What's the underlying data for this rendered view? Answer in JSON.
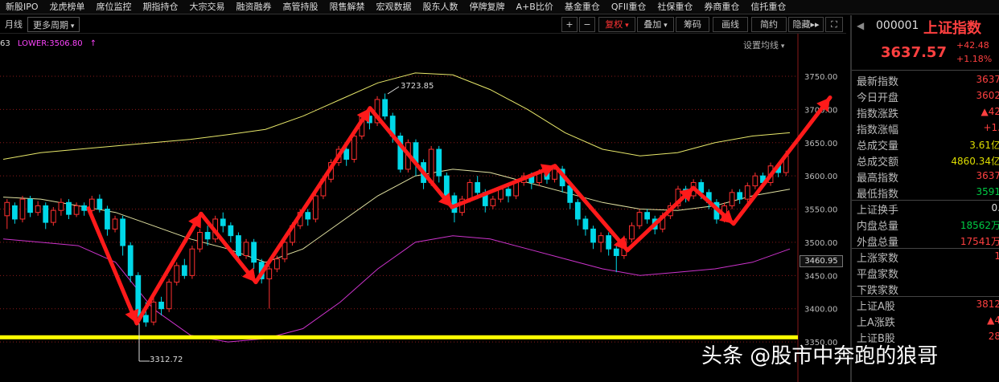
{
  "top_menu": [
    "新股IPO",
    "龙虎榜单",
    "席位监控",
    "期指持仓",
    "大宗交易",
    "融资融券",
    "高管持股",
    "限售解禁",
    "宏观数据",
    "股东人数",
    "停牌复牌",
    "A+B比价",
    "基金重仓",
    "QFII重仓",
    "社保重仓",
    "券商重仓",
    "信托重仓"
  ],
  "toolbar": {
    "month_label": "月线",
    "more_period_label": "更多周期",
    "plus_label": "+",
    "minus_label": "−",
    "restore_label": "复权",
    "overlay_label": "叠加",
    "chips_label": "筹码",
    "draw_label": "画线",
    "simple_label": "简约",
    "hide_label": "隐藏",
    "arrows_label": "▸▸",
    "expand_label": "⛶"
  },
  "indicator": {
    "left_text": "63",
    "lower_text": "LOWER:3506.80",
    "arrow": "↑"
  },
  "set_ma_label": "设置均线",
  "chart_data": {
    "type": "candlestick",
    "y_axis": {
      "range": [
        3330,
        3790
      ],
      "ticks": [
        3350,
        3400,
        3450,
        3500,
        3550,
        3600,
        3650,
        3700,
        3750
      ],
      "tick_labels": [
        "3350.00",
        "3400.00",
        "3450.00",
        "3500.00",
        "3550.00",
        "3600.00",
        "3650.00",
        "3700.00",
        "3750.00"
      ]
    },
    "annotations": {
      "high": "3723.85",
      "low": "3312.72",
      "current": "3460.95"
    },
    "support_level": 3357,
    "zigzag_points": [
      3551,
      3378,
      3543,
      3440,
      3702,
      3553,
      3615,
      3488,
      3582,
      3528,
      3718
    ],
    "candles": [
      [
        3540,
        3560,
        3520,
        3565
      ],
      [
        3555,
        3535,
        3528,
        3560
      ],
      [
        3535,
        3565,
        3530,
        3570
      ],
      [
        3565,
        3545,
        3538,
        3570
      ],
      [
        3545,
        3555,
        3540,
        3562
      ],
      [
        3555,
        3530,
        3520,
        3560
      ],
      [
        3530,
        3548,
        3525,
        3553
      ],
      [
        3548,
        3560,
        3540,
        3566
      ],
      [
        3560,
        3542,
        3535,
        3565
      ],
      [
        3542,
        3555,
        3538,
        3560
      ],
      [
        3555,
        3548,
        3540,
        3560
      ],
      [
        3548,
        3565,
        3545,
        3570
      ],
      [
        3565,
        3550,
        3545,
        3572
      ],
      [
        3550,
        3520,
        3510,
        3555
      ],
      [
        3520,
        3535,
        3515,
        3540
      ],
      [
        3535,
        3495,
        3480,
        3540
      ],
      [
        3495,
        3450,
        3440,
        3500
      ],
      [
        3450,
        3390,
        3380,
        3455
      ],
      [
        3390,
        3380,
        3373,
        3410
      ],
      [
        3380,
        3410,
        3375,
        3420
      ],
      [
        3410,
        3400,
        3390,
        3418
      ],
      [
        3400,
        3440,
        3395,
        3445
      ],
      [
        3440,
        3465,
        3435,
        3470
      ],
      [
        3465,
        3450,
        3445,
        3475
      ],
      [
        3450,
        3490,
        3445,
        3495
      ],
      [
        3490,
        3515,
        3485,
        3520
      ],
      [
        3515,
        3505,
        3495,
        3525
      ],
      [
        3505,
        3535,
        3500,
        3540
      ],
      [
        3535,
        3525,
        3515,
        3545
      ],
      [
        3525,
        3510,
        3500,
        3530
      ],
      [
        3510,
        3480,
        3470,
        3515
      ],
      [
        3480,
        3500,
        3475,
        3505
      ],
      [
        3500,
        3470,
        3460,
        3505
      ],
      [
        3470,
        3445,
        3438,
        3475
      ],
      [
        3445,
        3460,
        3400,
        3465
      ],
      [
        3460,
        3475,
        3455,
        3480
      ],
      [
        3475,
        3500,
        3470,
        3505
      ],
      [
        3500,
        3525,
        3495,
        3530
      ],
      [
        3525,
        3545,
        3520,
        3550
      ],
      [
        3545,
        3535,
        3525,
        3550
      ],
      [
        3535,
        3570,
        3530,
        3575
      ],
      [
        3570,
        3595,
        3565,
        3600
      ],
      [
        3595,
        3620,
        3590,
        3625
      ],
      [
        3620,
        3640,
        3615,
        3645
      ],
      [
        3640,
        3625,
        3615,
        3645
      ],
      [
        3625,
        3660,
        3620,
        3665
      ],
      [
        3660,
        3690,
        3655,
        3695
      ],
      [
        3690,
        3680,
        3670,
        3700
      ],
      [
        3680,
        3715,
        3675,
        3720
      ],
      [
        3715,
        3690,
        3685,
        3724
      ],
      [
        3690,
        3660,
        3650,
        3695
      ],
      [
        3660,
        3610,
        3605,
        3665
      ],
      [
        3610,
        3650,
        3605,
        3655
      ],
      [
        3650,
        3620,
        3600,
        3655
      ],
      [
        3620,
        3590,
        3580,
        3625
      ],
      [
        3590,
        3640,
        3585,
        3645
      ],
      [
        3640,
        3600,
        3590,
        3645
      ],
      [
        3600,
        3570,
        3560,
        3605
      ],
      [
        3570,
        3545,
        3530,
        3575
      ],
      [
        3545,
        3565,
        3540,
        3570
      ],
      [
        3565,
        3590,
        3560,
        3595
      ],
      [
        3590,
        3575,
        3565,
        3600
      ],
      [
        3575,
        3555,
        3545,
        3580
      ],
      [
        3555,
        3565,
        3550,
        3570
      ],
      [
        3565,
        3580,
        3560,
        3585
      ],
      [
        3580,
        3570,
        3560,
        3585
      ],
      [
        3570,
        3590,
        3565,
        3595
      ],
      [
        3590,
        3600,
        3585,
        3605
      ],
      [
        3600,
        3590,
        3580,
        3605
      ],
      [
        3590,
        3605,
        3585,
        3610
      ],
      [
        3605,
        3595,
        3588,
        3610
      ],
      [
        3595,
        3610,
        3590,
        3615
      ],
      [
        3610,
        3585,
        3575,
        3615
      ],
      [
        3585,
        3560,
        3550,
        3590
      ],
      [
        3560,
        3535,
        3525,
        3565
      ],
      [
        3535,
        3520,
        3510,
        3540
      ],
      [
        3520,
        3500,
        3490,
        3525
      ],
      [
        3500,
        3510,
        3485,
        3515
      ],
      [
        3510,
        3490,
        3480,
        3515
      ],
      [
        3490,
        3480,
        3455,
        3495
      ],
      [
        3480,
        3505,
        3475,
        3510
      ],
      [
        3505,
        3525,
        3500,
        3530
      ],
      [
        3525,
        3545,
        3520,
        3550
      ],
      [
        3545,
        3535,
        3528,
        3550
      ],
      [
        3535,
        3520,
        3512,
        3540
      ],
      [
        3520,
        3540,
        3515,
        3545
      ],
      [
        3540,
        3555,
        3535,
        3560
      ],
      [
        3555,
        3580,
        3550,
        3585
      ],
      [
        3580,
        3570,
        3560,
        3585
      ],
      [
        3570,
        3590,
        3565,
        3595
      ],
      [
        3590,
        3575,
        3565,
        3595
      ],
      [
        3575,
        3560,
        3550,
        3580
      ],
      [
        3560,
        3535,
        3528,
        3565
      ],
      [
        3535,
        3555,
        3530,
        3560
      ],
      [
        3555,
        3575,
        3550,
        3580
      ],
      [
        3575,
        3565,
        3558,
        3580
      ],
      [
        3565,
        3585,
        3560,
        3590
      ],
      [
        3585,
        3600,
        3580,
        3605
      ],
      [
        3600,
        3590,
        3583,
        3605
      ],
      [
        3590,
        3615,
        3585,
        3620
      ],
      [
        3615,
        3605,
        3598,
        3620
      ],
      [
        3605,
        3630,
        3600,
        3638
      ]
    ],
    "upper_band": [
      3625,
      3635,
      3640,
      3645,
      3650,
      3655,
      3662,
      3670,
      3690,
      3715,
      3740,
      3755,
      3752,
      3730,
      3700,
      3665,
      3640,
      3630,
      3635,
      3650,
      3660,
      3665
    ],
    "middle_band": [
      3568,
      3565,
      3555,
      3545,
      3525,
      3505,
      3490,
      3470,
      3490,
      3530,
      3570,
      3600,
      3610,
      3605,
      3590,
      3575,
      3560,
      3550,
      3548,
      3555,
      3570,
      3580
    ],
    "lower_band": [
      3505,
      3500,
      3495,
      3470,
      3400,
      3360,
      3350,
      3355,
      3370,
      3410,
      3460,
      3500,
      3510,
      3505,
      3490,
      3475,
      3460,
      3450,
      3455,
      3460,
      3470,
      3490
    ]
  },
  "right_panel": {
    "code": "000001",
    "name": "上证指数",
    "price": "3637.57",
    "change": "+42.48",
    "change_pct": "+1.18%",
    "rows": [
      {
        "k": "最新指数",
        "v": "3637",
        "color": "#ff4040"
      },
      {
        "k": "今日开盘",
        "v": "3602",
        "color": "#ff4040"
      },
      {
        "k": "指数涨跌",
        "v": "▲42",
        "color": "#ff4040"
      },
      {
        "k": "指数涨幅",
        "v": "+1.",
        "color": "#ff4040"
      },
      {
        "k": "总成交量",
        "v": "3.61亿",
        "color": "#dddd00"
      },
      {
        "k": "总成交额",
        "v": "4860.34亿",
        "color": "#dddd00"
      },
      {
        "k": "最高指数",
        "v": "3637",
        "color": "#ff4040"
      },
      {
        "k": "最低指数",
        "v": "3591",
        "color": "#00cc44"
      },
      {
        "k": "上证换手",
        "v": "0.",
        "color": "#dddddd"
      },
      {
        "k": "内盘总量",
        "v": "18562万",
        "color": "#00cc44"
      },
      {
        "k": "外盘总量",
        "v": "17541万",
        "color": "#ff4040"
      },
      {
        "k": "上涨家数",
        "v": "1",
        "color": "#ff4040"
      },
      {
        "k": "平盘家数",
        "v": "",
        "color": "#dddddd"
      },
      {
        "k": "下跌家数",
        "v": "",
        "color": "#00cc44"
      },
      {
        "k": "上证A股",
        "v": "3812",
        "color": "#ff4040"
      },
      {
        "k": "上A涨跌",
        "v": "▲4",
        "color": "#ff4040"
      },
      {
        "k": "上证B股",
        "v": "28",
        "color": "#ff4040"
      }
    ]
  },
  "watermark": "头条 @股市中奔跑的狼哥",
  "colors": {
    "up": "#ff3030",
    "down": "#00d8e8",
    "upper_band": "#e8e86a",
    "middle_band": "#e0e0a0",
    "lower_band": "#cc33cc",
    "support": "#ffff00",
    "zigzag": "#ff1a1a"
  }
}
